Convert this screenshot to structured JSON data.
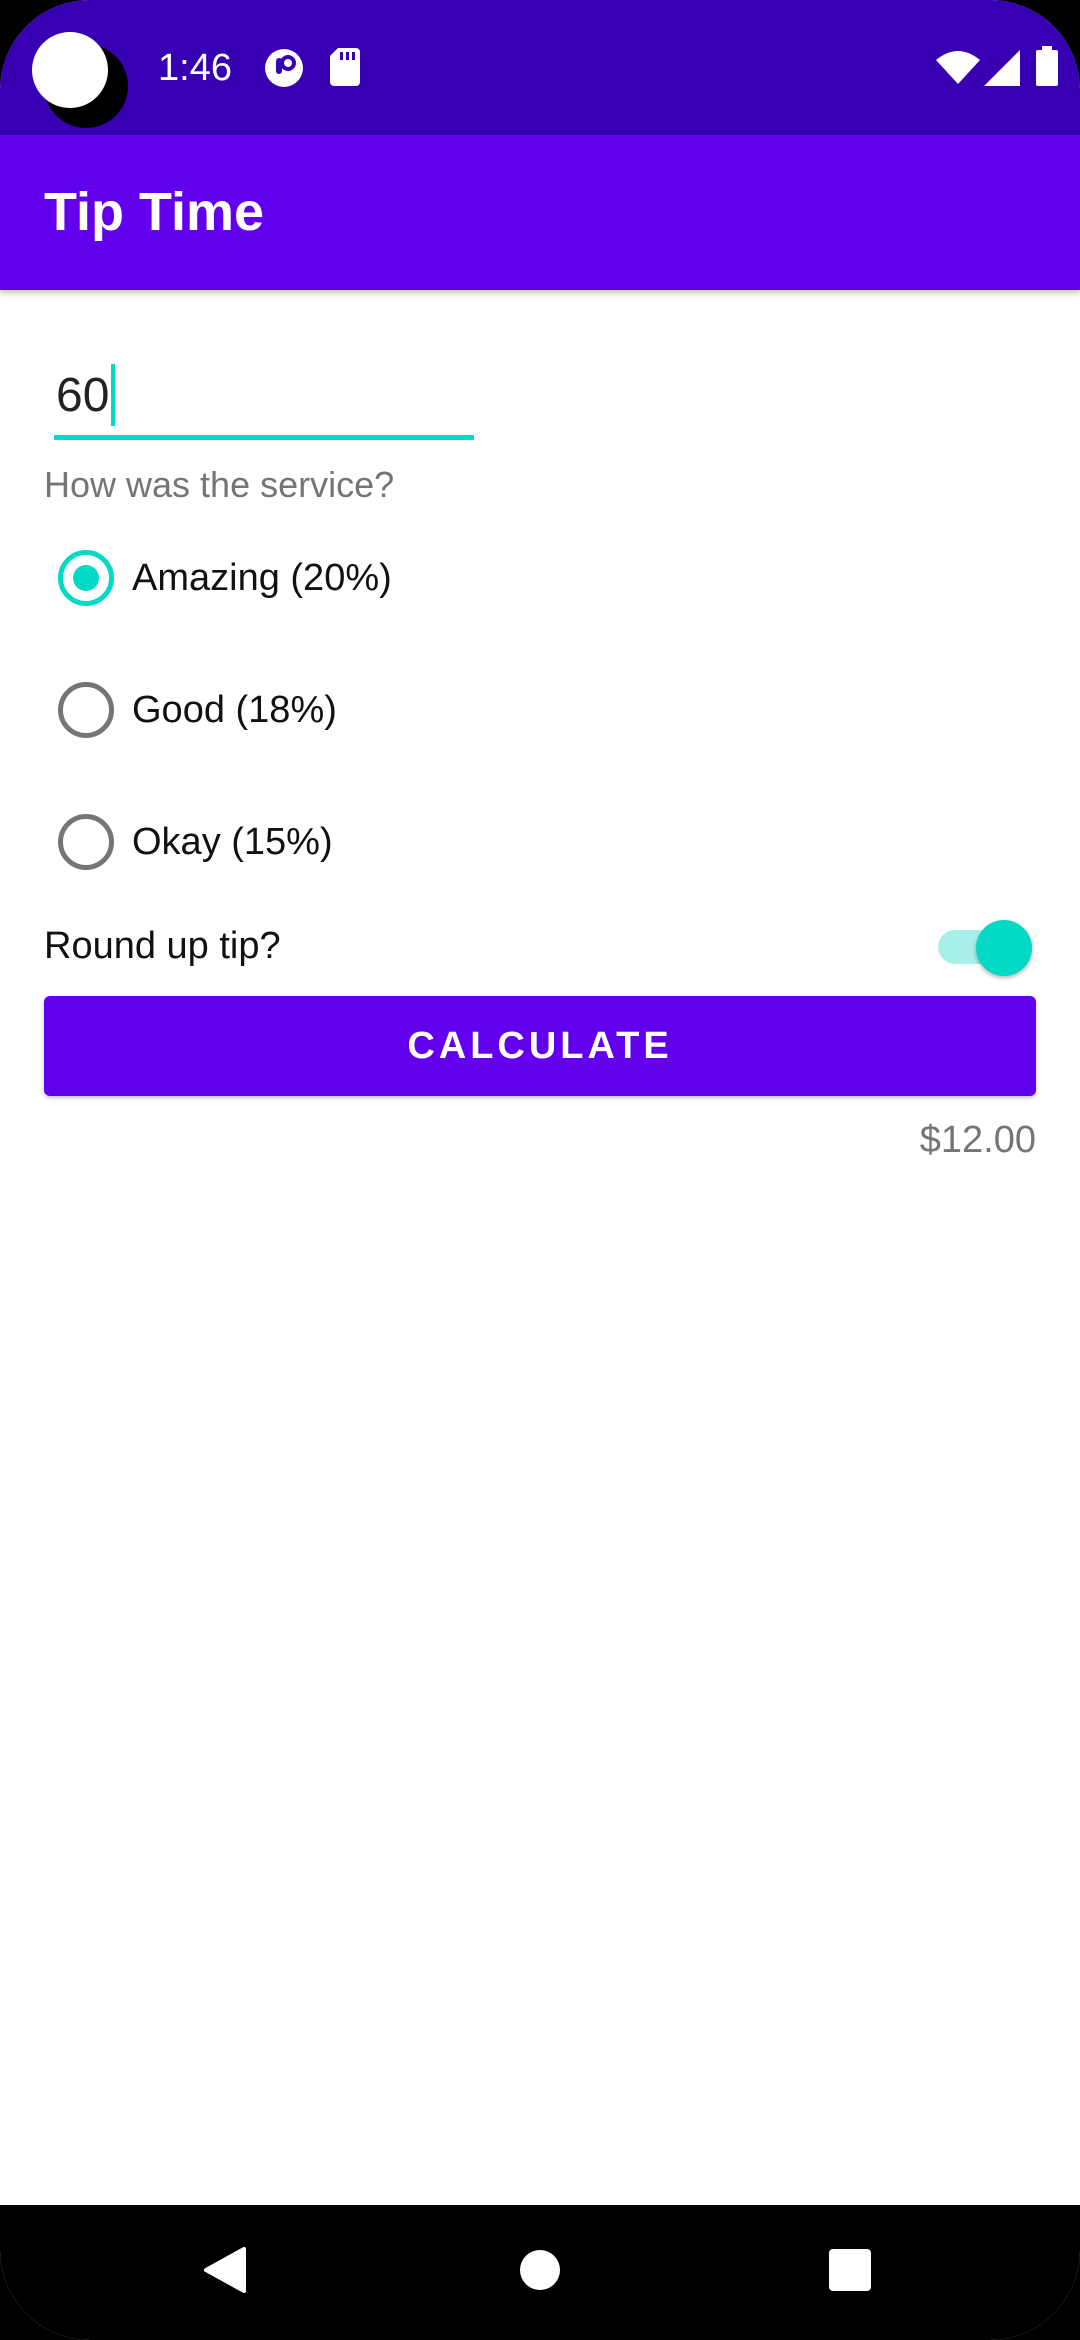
{
  "status_bar": {
    "time": "1:46",
    "icons": [
      "camera-cutout",
      "app-notification-icon",
      "sd-card-icon",
      "wifi-icon",
      "signal-icon",
      "battery-icon"
    ]
  },
  "app_bar": {
    "title": "Tip Time"
  },
  "form": {
    "cost_value": "60",
    "service_question": "How was the service?",
    "options": [
      {
        "label": "Amazing (20%)",
        "checked": true
      },
      {
        "label": "Good (18%)",
        "checked": false
      },
      {
        "label": "Okay (15%)",
        "checked": false
      }
    ],
    "round_up_label": "Round up tip?",
    "round_up_on": true,
    "calculate_label": "CALCULATE",
    "tip_result": "$12.00"
  },
  "nav_bar": {
    "icons": [
      "back-icon",
      "home-icon",
      "recents-icon"
    ]
  },
  "colors": {
    "status_bar": "#3700B3",
    "primary": "#6200EE",
    "accent": "#03DAC5",
    "secondary_text": "#757575"
  }
}
